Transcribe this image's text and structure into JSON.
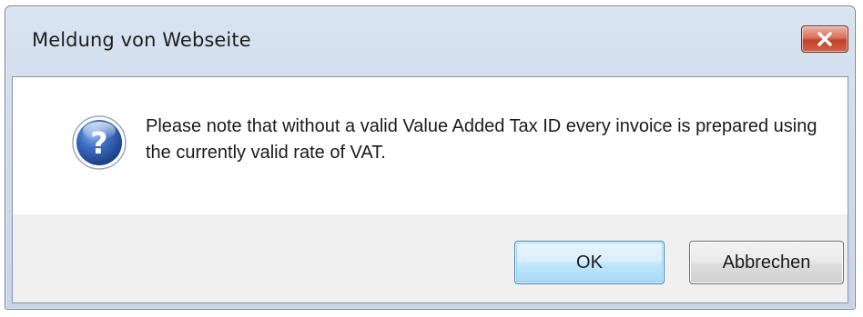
{
  "dialog": {
    "title": "Meldung von Webseite",
    "message": "Please note that without a valid Value Added Tax ID every invoice is prepared using the currently valid rate of VAT.",
    "icon": "question-icon",
    "close_icon": "close-icon",
    "buttons": {
      "ok_label": "OK",
      "cancel_label": "Abbrechen"
    }
  },
  "colors": {
    "close_button": "#c7432e",
    "ok_button_border": "#3c7fb1",
    "question_icon": "#2a5fb0"
  }
}
